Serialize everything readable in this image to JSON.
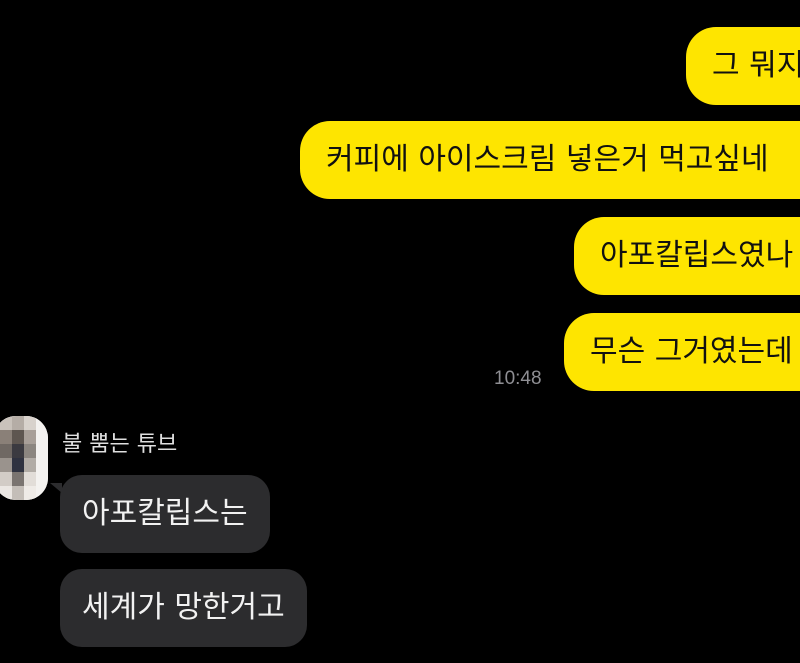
{
  "outgoing_messages": [
    {
      "text": "그 뭐지"
    },
    {
      "text": "커피에 아이스크림 넣은거 먹고싶네"
    },
    {
      "text": "아포칼립스였나"
    },
    {
      "text": "무슨 그거였는데"
    }
  ],
  "outgoing_time": "10:48",
  "sender": {
    "name": "불 뿜는 튜브"
  },
  "incoming_messages": [
    {
      "text": "아포칼립스는"
    },
    {
      "text": "세계가 망한거고"
    }
  ],
  "colors": {
    "background": "#000000",
    "outgoing_bubble": "#FEE500",
    "incoming_bubble": "#2C2C2E",
    "timestamp": "#8E8E93"
  }
}
